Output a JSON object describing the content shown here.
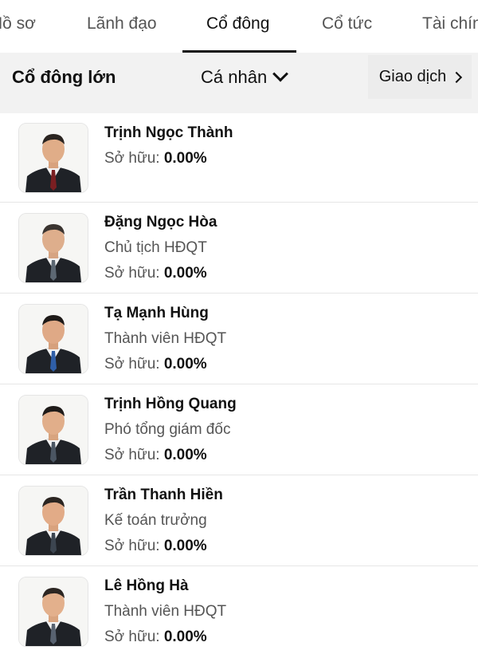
{
  "tabs": [
    {
      "label": "Hồ sơ"
    },
    {
      "label": "Lãnh đạo"
    },
    {
      "label": "Cổ đông"
    },
    {
      "label": "Cổ tức"
    },
    {
      "label": "Tài chính"
    }
  ],
  "subheader": {
    "title": "Cổ đông lớn",
    "filter_label": "Cá nhân",
    "trade_label": "Giao dịch"
  },
  "ownership_label": "Sở hữu:",
  "shareholders": [
    {
      "name": "Trịnh Ngọc Thành",
      "role": "",
      "ownership": "0.00%"
    },
    {
      "name": "Đặng Ngọc Hòa",
      "role": "Chủ tịch HĐQT",
      "ownership": "0.00%"
    },
    {
      "name": "Tạ Mạnh Hùng",
      "role": "Thành viên HĐQT",
      "ownership": "0.00%"
    },
    {
      "name": "Trịnh Hồng Quang",
      "role": "Phó tổng giám đốc",
      "ownership": "0.00%"
    },
    {
      "name": "Trần Thanh Hiền",
      "role": "Kế toán trưởng",
      "ownership": "0.00%"
    },
    {
      "name": "Lê Hồng Hà",
      "role": "Thành viên HĐQT",
      "ownership": "0.00%"
    }
  ],
  "colors": {
    "text": "#111111",
    "muted": "#555555",
    "subbar_bg": "#f2f2f2",
    "divider": "#e6e6e6"
  }
}
